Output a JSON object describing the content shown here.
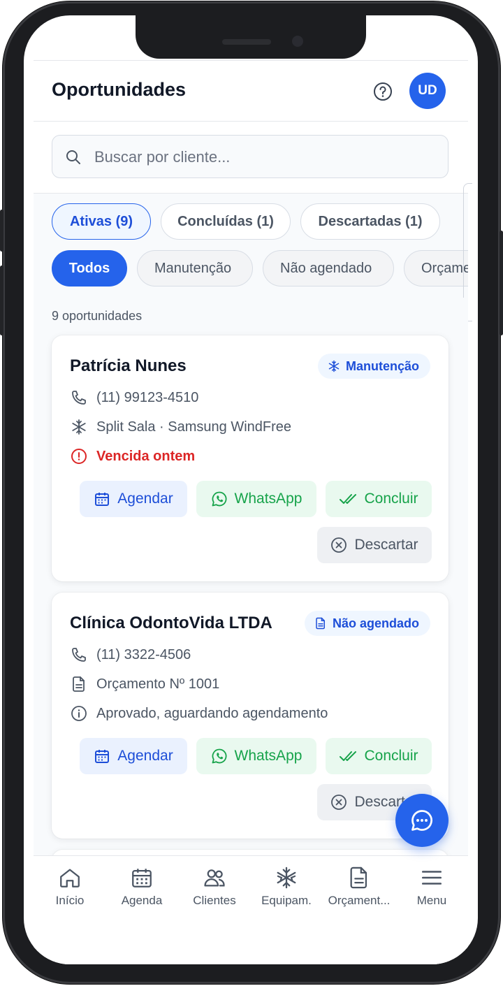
{
  "header": {
    "title": "Oportunidades",
    "avatar_initials": "UD"
  },
  "search": {
    "placeholder": "Buscar por cliente..."
  },
  "status_tabs": [
    {
      "label": "Ativas (9)",
      "active": true
    },
    {
      "label": "Concluídas (1)",
      "active": false
    },
    {
      "label": "Descartadas (1)",
      "active": false
    }
  ],
  "type_filters": [
    {
      "label": "Todos",
      "active": true
    },
    {
      "label": "Manutenção",
      "active": false
    },
    {
      "label": "Não agendado",
      "active": false
    },
    {
      "label": "Orçame",
      "active": false
    }
  ],
  "count_label": "9 oportunidades",
  "cards": [
    {
      "name": "Patrícia Nunes",
      "tag": {
        "label": "Manutenção",
        "icon": "snowflake-icon"
      },
      "phone": "(11) 99123-4510",
      "detail": {
        "text": "Split Sala · Samsung WindFree",
        "icon": "snowflake-icon"
      },
      "status": {
        "text": "Vencida ontem",
        "icon": "alert-circle-icon",
        "tone": "danger"
      },
      "actions": {
        "schedule": "Agendar",
        "whatsapp": "WhatsApp",
        "complete": "Concluir",
        "discard": "Descartar"
      }
    },
    {
      "name": "Clínica OdontoVida LTDA",
      "tag": {
        "label": "Não agendado",
        "icon": "document-icon"
      },
      "phone": "(11) 3322-4506",
      "detail": {
        "text": "Orçamento Nº 1001",
        "icon": "document-icon"
      },
      "status": {
        "text": "Aprovado, aguardando agendamento",
        "icon": "info-icon",
        "tone": "neutral"
      },
      "actions": {
        "schedule": "Agendar",
        "whatsapp": "WhatsApp",
        "complete": "Concluir",
        "discard": "Descartar"
      }
    }
  ],
  "bottom_nav": [
    {
      "label": "Início",
      "icon": "home-icon"
    },
    {
      "label": "Agenda",
      "icon": "calendar-icon"
    },
    {
      "label": "Clientes",
      "icon": "users-icon"
    },
    {
      "label": "Equipam.",
      "icon": "snowflake-icon"
    },
    {
      "label": "Orçament...",
      "icon": "document-icon"
    },
    {
      "label": "Menu",
      "icon": "menu-icon"
    }
  ],
  "colors": {
    "primary": "#2563eb",
    "success": "#16a34a",
    "danger": "#dc2626",
    "text": "#111827",
    "muted": "#4b5563"
  }
}
